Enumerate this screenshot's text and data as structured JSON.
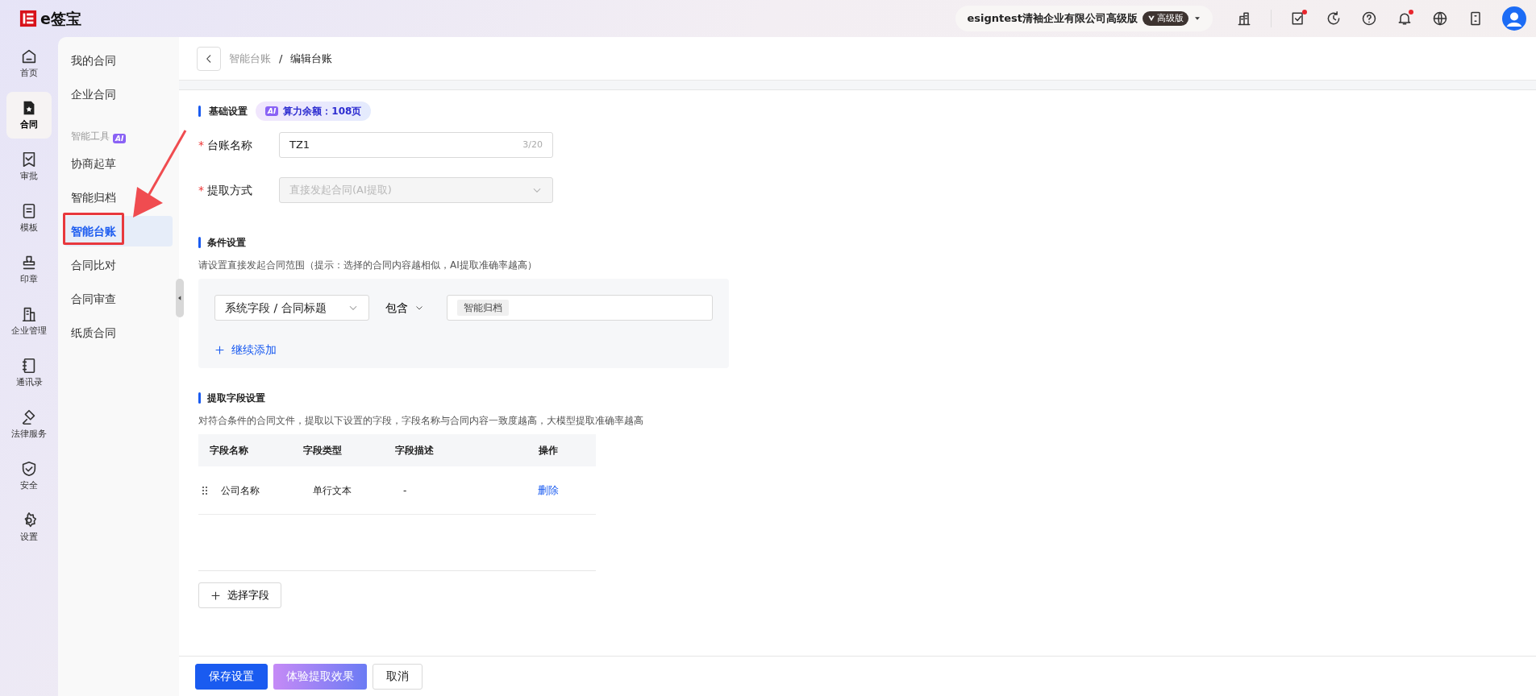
{
  "app": {
    "logo": "e签宝"
  },
  "topbar": {
    "org": "esigntest清袖企业有限公司高级版",
    "plan_badge": "高级版",
    "icons": [
      {
        "dot": false
      },
      {
        "dot": true
      },
      {
        "dot": false
      },
      {
        "dot": false
      },
      {
        "dot": true
      },
      {
        "dot": false
      },
      {
        "dot": false
      }
    ]
  },
  "rail": [
    {
      "label": "首页",
      "selected": false
    },
    {
      "label": "合同",
      "selected": true
    },
    {
      "label": "审批",
      "selected": false
    },
    {
      "label": "模板",
      "selected": false
    },
    {
      "label": "印章",
      "selected": false
    },
    {
      "label": "企业管理",
      "selected": false
    },
    {
      "label": "通讯录",
      "selected": false
    },
    {
      "label": "法律服务",
      "selected": false
    },
    {
      "label": "安全",
      "selected": false
    },
    {
      "label": "设置",
      "selected": false
    }
  ],
  "sidebar": {
    "items": [
      {
        "kind": "link",
        "label": "我的合同",
        "selected": false
      },
      {
        "kind": "link",
        "label": "企业合同",
        "selected": false
      },
      {
        "kind": "heading",
        "label": "智能工具",
        "tag": "AI"
      },
      {
        "kind": "link",
        "label": "协商起草",
        "selected": false
      },
      {
        "kind": "link",
        "label": "智能归档",
        "selected": false
      },
      {
        "kind": "link",
        "label": "智能台账",
        "selected": true
      },
      {
        "kind": "link",
        "label": "合同比对",
        "selected": false
      },
      {
        "kind": "link",
        "label": "合同审查",
        "selected": false
      },
      {
        "kind": "link",
        "label": "纸质合同",
        "selected": false
      }
    ]
  },
  "breadcrumb": [
    "智能台账",
    "编辑台账"
  ],
  "breadcrumb_separator": "/",
  "basic": {
    "title": "基础设置",
    "quota_tag": "AI",
    "quota": "算力余额：108页",
    "name_mark": "*",
    "method_mark": "*",
    "name_label": "台账名称",
    "name_value": "TZ1",
    "name_count": "3/20",
    "method_label": "提取方式",
    "method_value": "直接发起合同(AI提取)",
    "method_disabled": true
  },
  "conditions": {
    "title": "条件设置",
    "hint": "请设置直接发起合同范围（提示：选择的合同内容越相似，AI提取准确率越高）",
    "rules": [
      {
        "field": "系统字段 / 合同标题",
        "operator": "包含",
        "values": [
          "智能归档"
        ]
      }
    ],
    "add": "继续添加"
  },
  "fields": {
    "title": "提取字段设置",
    "hint": "对符合条件的合同文件，提取以下设置的字段，字段名称与合同内容一致度越高，大模型提取准确率越高",
    "table": {
      "columns": [
        "字段名称",
        "字段类型",
        "字段描述",
        "操作"
      ],
      "rows": [
        {
          "name": "公司名称",
          "type": "单行文本",
          "description": "-",
          "action": "删除"
        }
      ]
    },
    "choose": "选择字段"
  },
  "footer": {
    "buttons": [
      {
        "label": "保存设置",
        "kind": "primary"
      },
      {
        "label": "体验提取效果",
        "kind": "gradient"
      },
      {
        "label": "取消",
        "kind": "plain"
      }
    ]
  }
}
